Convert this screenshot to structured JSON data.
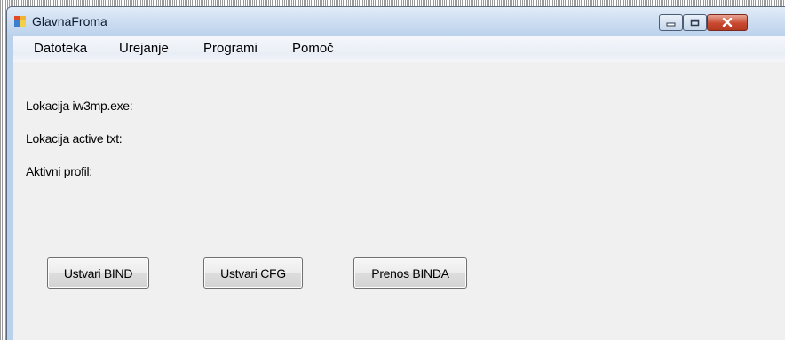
{
  "window": {
    "title": "GlavnaFroma"
  },
  "icons": {
    "app": "application-icon",
    "minimize": "minimize-icon",
    "maximize": "maximize-icon",
    "close": "close-icon"
  },
  "menu": {
    "items": [
      "Datoteka",
      "Urejanje",
      "Programi",
      "Pomoč"
    ]
  },
  "labels": {
    "exe_location": "Lokacija iw3mp.exe:",
    "active_txt_location": "Lokacija active txt:",
    "active_profile": "Aktivni profil:"
  },
  "buttons": {
    "create_bind": "Ustvari BIND",
    "create_cfg": "Ustvari CFG",
    "transfer_binda": "Prenos BINDA"
  },
  "colors": {
    "title_bar": "#cfdff2",
    "menu_bar": "#eef2f8",
    "client_area": "#f0f0f0",
    "close_button": "#c8482e"
  }
}
